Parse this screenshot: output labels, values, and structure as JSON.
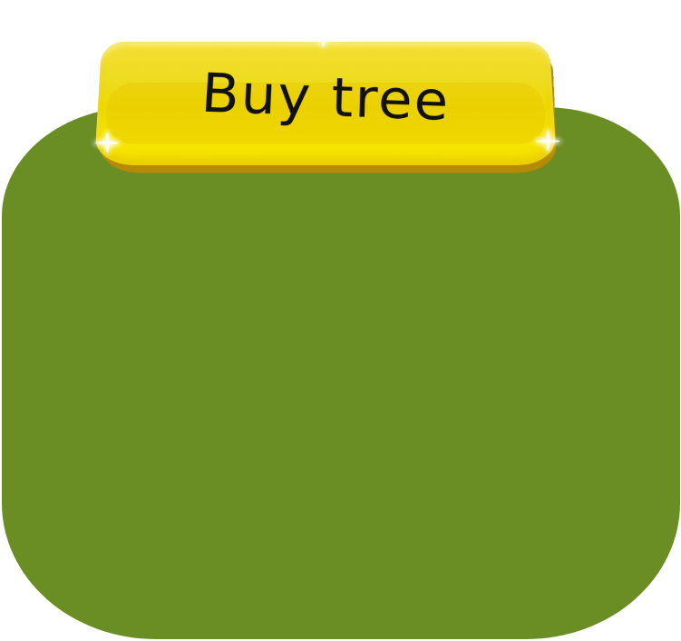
{
  "dialog": {
    "title": "Buy tree",
    "panel_color": "#6a8d24",
    "banner_color": "#f2dd1a"
  },
  "decorations": {
    "sparkles": [
      "sparkle-icon",
      "sparkle-icon",
      "sparkle-icon"
    ]
  }
}
